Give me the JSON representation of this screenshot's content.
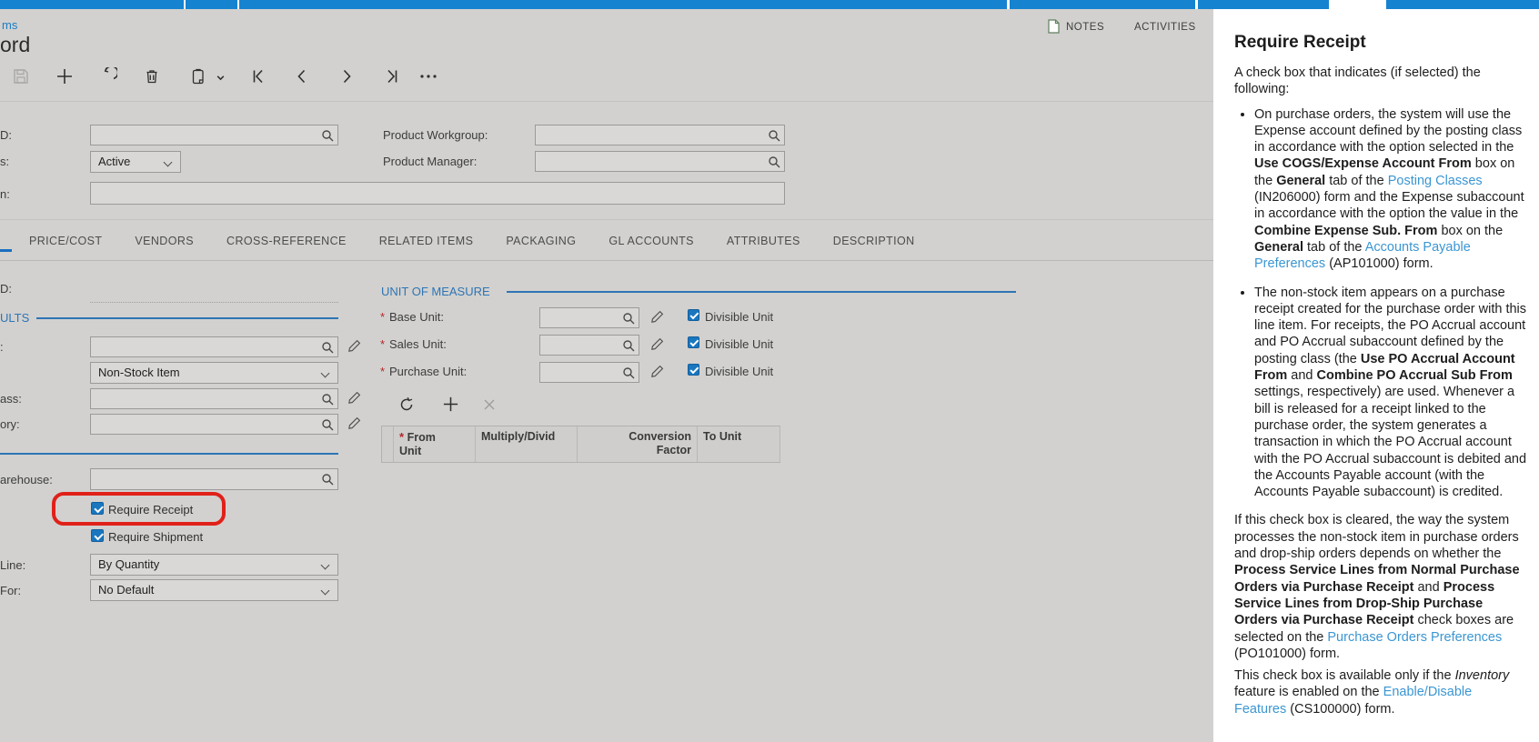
{
  "chrome": {
    "tab_bar_color": "#1583d0"
  },
  "header": {
    "breadcrumb": "ms",
    "title": "ord"
  },
  "link_bar": {
    "notes": "NOTES",
    "activities": "ACTIVITIES"
  },
  "toolbar": {
    "icons": [
      "save-icon",
      "add-record-icon",
      "undo-icon",
      "delete-icon",
      "copy-paste-icon",
      "copy-paste-dropdown-icon",
      "first-record-icon",
      "previous-record-icon",
      "next-record-icon",
      "last-record-icon",
      "more-actions-icon"
    ]
  },
  "summary": {
    "left": [
      {
        "label": "D:",
        "value": "",
        "control": "lookup"
      },
      {
        "label": "s:",
        "value": "Active",
        "control": "select"
      },
      {
        "label": "n:",
        "value": "",
        "control": "text"
      }
    ],
    "right": [
      {
        "label": "Product Workgroup:",
        "value": "",
        "control": "lookup"
      },
      {
        "label": "Product Manager:",
        "value": "",
        "control": "lookup"
      }
    ]
  },
  "tabs": [
    "PRICE/COST",
    "VENDORS",
    "CROSS-REFERENCE",
    "RELATED ITEMS",
    "PACKAGING",
    "GL ACCOUNTS",
    "ATTRIBUTES",
    "DESCRIPTION"
  ],
  "general": {
    "template_label": "D:",
    "defaults_section_title": "ULTS",
    "fields": [
      {
        "label": ":",
        "value": "",
        "control": "lookup",
        "pencil": true
      },
      {
        "label": "",
        "value": "Non-Stock Item",
        "control": "select"
      },
      {
        "label": "ass:",
        "value": "",
        "control": "lookup",
        "pencil": true
      },
      {
        "label": "ory:",
        "value": "",
        "control": "lookup",
        "pencil": true
      }
    ],
    "warehouse_label": "arehouse:",
    "checkboxes": [
      {
        "label": "Require Receipt",
        "checked": true,
        "highlighted": true
      },
      {
        "label": "Require Shipment",
        "checked": true
      }
    ],
    "selects": [
      {
        "label": "Line:",
        "value": "By Quantity"
      },
      {
        "label": "For:",
        "value": "No Default"
      }
    ]
  },
  "uom": {
    "section_title": "UNIT OF MEASURE",
    "divisible_label": "Divisible Unit",
    "rows": [
      {
        "label": "Base Unit:",
        "required": true,
        "divisible_checked": true
      },
      {
        "label": "Sales Unit:",
        "required": true,
        "divisible_checked": true
      },
      {
        "label": "Purchase Unit:",
        "required": true,
        "divisible_checked": true
      }
    ],
    "grid_toolbar": [
      "refresh-icon",
      "add-row-icon",
      "delete-row-icon"
    ],
    "grid_columns": [
      {
        "label": "From Unit",
        "required": true,
        "align": "left"
      },
      {
        "label": "Multiply/Divid",
        "align": "left"
      },
      {
        "label": "Conversion Factor",
        "align": "right"
      },
      {
        "label": "To Unit",
        "align": "left"
      }
    ]
  },
  "help": {
    "title": "Require Receipt",
    "blocks": [
      {
        "type": "p",
        "segments": [
          {
            "text": "A check box that indicates (if selected) the following:"
          }
        ]
      },
      {
        "type": "bullet",
        "segments": [
          {
            "text": "On purchase orders, the system will use the Expense account defined by the posting class in accordance with the option selected in the "
          },
          {
            "text": "Use COGS/Expense Account From",
            "style": "bold"
          },
          {
            "text": " box on the "
          },
          {
            "text": "General",
            "style": "bold"
          },
          {
            "text": " tab of the "
          },
          {
            "text": "Posting Classes",
            "style": "link"
          },
          {
            "text": " (IN206000) form and the Expense subaccount in accordance with the option the value in the "
          },
          {
            "text": "Combine Expense Sub. From",
            "style": "bold"
          },
          {
            "text": " box on the "
          },
          {
            "text": "General",
            "style": "bold"
          },
          {
            "text": " tab of the "
          },
          {
            "text": "Accounts Payable Preferences",
            "style": "link"
          },
          {
            "text": " (AP101000) form."
          }
        ]
      },
      {
        "type": "bullet",
        "segments": [
          {
            "text": "The non-stock item appears on a purchase receipt created for the purchase order with this line item. For receipts, the PO Accrual account and PO Accrual subaccount defined by the posting class (the "
          },
          {
            "text": "Use PO Accrual Account From",
            "style": "bold"
          },
          {
            "text": " and "
          },
          {
            "text": "Combine PO Accrual Sub From",
            "style": "bold"
          },
          {
            "text": " settings, respectively) are used. Whenever a bill is released for a receipt linked to the purchase order, the system generates a transaction in which the PO Accrual account with the PO Accrual subaccount is debited and the Accounts Payable account (with the Accounts Payable subaccount) is credited."
          }
        ]
      },
      {
        "type": "p",
        "segments": [
          {
            "text": "If this check box is cleared, the way the system processes the non-stock item in purchase orders and drop-ship orders depends on whether the "
          },
          {
            "text": "Process Service Lines from Normal Purchase Orders via Purchase Receipt",
            "style": "bold"
          },
          {
            "text": " and "
          },
          {
            "text": "Process Service Lines from Drop-Ship Purchase Orders via Purchase Receipt",
            "style": "bold"
          },
          {
            "text": " check boxes are selected on the "
          },
          {
            "text": "Purchase Orders Preferences",
            "style": "link"
          },
          {
            "text": " (PO101000) form."
          }
        ]
      },
      {
        "type": "p",
        "tight": true,
        "segments": [
          {
            "text": "This check box is available only if the "
          },
          {
            "text": "Inventory",
            "style": "italic"
          },
          {
            "text": " feature is enabled on the "
          },
          {
            "text": "Enable/Disable Features",
            "style": "link"
          },
          {
            "text": " (CS100000) form."
          }
        ]
      }
    ]
  },
  "colors": {
    "topbar_blue": "#1583d0",
    "section_accent_blue": "#2e75b5",
    "link_blue": "#3a96d2",
    "highlight_red": "#e02119",
    "checkbox_blue": "#1976bf",
    "tab_active_underline": "#1a6fc0"
  }
}
